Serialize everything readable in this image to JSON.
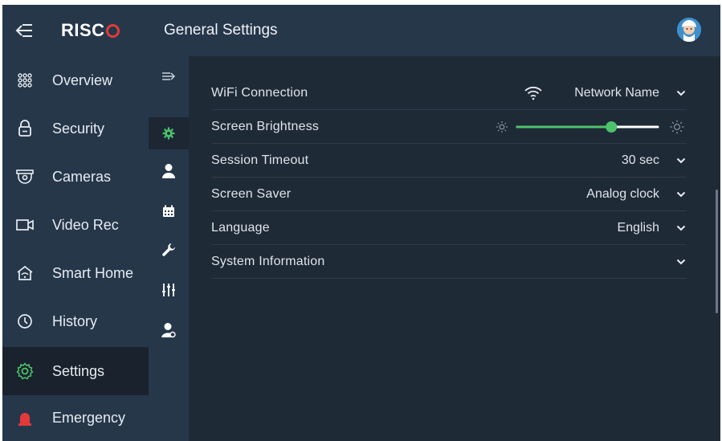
{
  "app": {
    "logo_text": "RISC",
    "header_title": "General Settings"
  },
  "sidebar": {
    "items": [
      {
        "label": "Overview",
        "icon": "grid-icon"
      },
      {
        "label": "Security",
        "icon": "lock-icon"
      },
      {
        "label": "Cameras",
        "icon": "camera-icon"
      },
      {
        "label": "Video Rec",
        "icon": "video-icon"
      },
      {
        "label": "Smart Home",
        "icon": "home-icon"
      },
      {
        "label": "History",
        "icon": "history-icon"
      },
      {
        "label": "Settings",
        "icon": "gear-icon",
        "active": true
      },
      {
        "label": "Emergency",
        "icon": "siren-icon"
      }
    ]
  },
  "settings": {
    "wifi": {
      "label": "WiFi Connection",
      "value": "Network Name"
    },
    "brightness": {
      "label": "Screen Brightness",
      "level": 0.67
    },
    "timeout": {
      "label": "Session Timeout",
      "value": "30 sec"
    },
    "saver": {
      "label": "Screen Saver",
      "value": "Analog clock"
    },
    "language": {
      "label": "Language",
      "value": "English"
    },
    "sysinfo": {
      "label": "System Information"
    }
  },
  "colors": {
    "accent": "#4cc36a",
    "brand_red": "#e23a3a",
    "sidebar_bg": "#26374a",
    "content_bg": "#1f2a37"
  }
}
